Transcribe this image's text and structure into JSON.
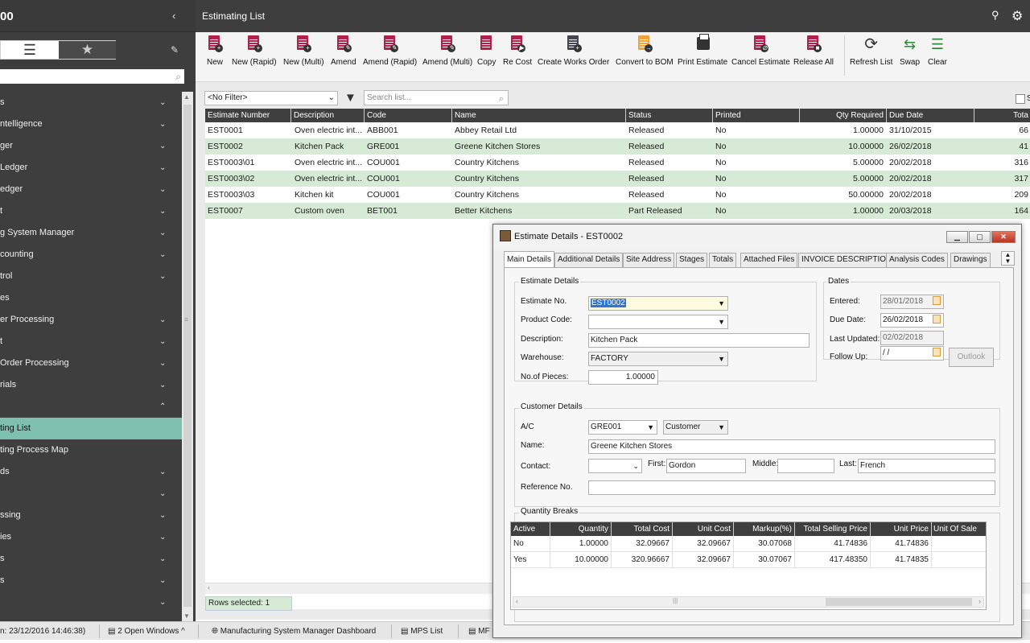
{
  "app": {
    "title": "00",
    "collapse_icon": "‹"
  },
  "sidebar": {
    "pencil_icon": "✎",
    "items": [
      {
        "label": "s",
        "chev": "⌄"
      },
      {
        "label": "ntelligence",
        "chev": "⌄"
      },
      {
        "label": "ger",
        "chev": "⌄"
      },
      {
        "label": "Ledger",
        "chev": "⌄"
      },
      {
        "label": "edger",
        "chev": "⌄"
      },
      {
        "label": "t",
        "chev": "⌄"
      },
      {
        "label": "g System Manager",
        "chev": "⌄"
      },
      {
        "label": "counting",
        "chev": "⌄"
      },
      {
        "label": "trol",
        "chev": "⌄"
      },
      {
        "label": "es",
        "chev": ""
      },
      {
        "label": "er Processing",
        "chev": "⌄"
      },
      {
        "label": "t",
        "chev": "⌄"
      },
      {
        "label": "Order Processing",
        "chev": "⌄"
      },
      {
        "label": "rials",
        "chev": "⌄"
      },
      {
        "label": "",
        "chev": "⌃"
      },
      {
        "label": "ting List",
        "chev": ""
      },
      {
        "label": "ting Process Map",
        "chev": ""
      },
      {
        "label": "ds",
        "chev": "⌄"
      },
      {
        "label": "",
        "chev": "⌄"
      },
      {
        "label": "ssing",
        "chev": "⌄"
      },
      {
        "label": "ies",
        "chev": "⌄"
      },
      {
        "label": "s",
        "chev": "⌄"
      },
      {
        "label": "s",
        "chev": "⌄"
      },
      {
        "label": "",
        "chev": "⌄"
      }
    ]
  },
  "topbar": {
    "title": "Estimating List"
  },
  "ribbon": {
    "buttons": [
      "New",
      "New (Rapid)",
      "New (Multi)",
      "Amend",
      "Amend (Rapid)",
      "Amend (Multi)",
      "Copy",
      "Re Cost",
      "Create Works Order",
      "Convert to BOM",
      "Print Estimate",
      "Cancel Estimate",
      "Release All",
      "Refresh List",
      "Swap",
      "Clear"
    ]
  },
  "list": {
    "filter": "<No Filter>",
    "search_placeholder": "Search list...",
    "columns": [
      "Estimate Number",
      "Description",
      "Code",
      "Name",
      "Status",
      "Printed",
      "Qty Required",
      "Due Date",
      "Tota"
    ],
    "rows": [
      [
        "EST0001",
        "Oven electric int...",
        "ABB001",
        "Abbey Retail Ltd",
        "Released",
        "No",
        "1.00000",
        "31/10/2015",
        "66"
      ],
      [
        "EST0002",
        "Kitchen Pack",
        "GRE001",
        "Greene Kitchen Stores",
        "Released",
        "No",
        "10.00000",
        "26/02/2018",
        "41"
      ],
      [
        "EST0003\\01",
        "Oven electric int...",
        "COU001",
        "Country Kitchens",
        "Released",
        "No",
        "5.00000",
        "20/02/2018",
        "316"
      ],
      [
        "EST0003\\02",
        "Oven electric int...",
        "COU001",
        "Country Kitchens",
        "Released",
        "No",
        "5.00000",
        "20/02/2018",
        "317"
      ],
      [
        "EST0003\\03",
        "Kitchen kit",
        "COU001",
        "Country Kitchens",
        "Released",
        "No",
        "50.00000",
        "20/02/2018",
        "209"
      ],
      [
        "EST0007",
        "Custom oven",
        "BET001",
        "Better Kitchens",
        "Part Released",
        "No",
        "1.00000",
        "20/03/2018",
        "164"
      ]
    ],
    "rows_selected": "Rows selected: 1",
    "show_checkbox_label": "S"
  },
  "statusbar": {
    "items": [
      "n: 23/12/2016 14:46:38)",
      "2 Open Windows ^",
      "Manufacturing System Manager Dashboard",
      "MPS List",
      "MF"
    ]
  },
  "dialog": {
    "title": "Estimate Details - EST0002",
    "tabs": [
      "Main Details",
      "Additional Details",
      "Site Address",
      "Stages",
      "Totals",
      "Attached Files",
      "INVOICE DESCRIPTION",
      "Analysis Codes",
      "Drawings"
    ],
    "estimate_details": {
      "group": "Estimate Details",
      "estimate_no_label": "Estimate No.",
      "estimate_no": "EST0002",
      "product_code_label": "Product Code:",
      "product_code": "",
      "description_label": "Description:",
      "description": "Kitchen Pack",
      "warehouse_label": "Warehouse:",
      "warehouse": "FACTORY",
      "pieces_label": "No.of Pieces:",
      "pieces": "1.00000"
    },
    "dates": {
      "group": "Dates",
      "entered_label": "Entered:",
      "entered": "28/01/2018",
      "due_label": "Due Date:",
      "due": "26/02/2018",
      "updated_label": "Last Updated:",
      "updated": "02/02/2018",
      "follow_label": "Follow Up:",
      "follow": " / /",
      "outlook": "Outlook"
    },
    "customer": {
      "group": "Customer Details",
      "ac_label": "A/C",
      "ac": "GRE001",
      "ac_type": "Customer",
      "name_label": "Name:",
      "name": "Greene Kitchen Stores",
      "contact_label": "Contact:",
      "first_label": "First:",
      "first": "Gordon",
      "middle_label": "Middle:",
      "middle": "",
      "last_label": "Last:",
      "last": "French",
      "ref_label": "Reference No.",
      "ref": ""
    },
    "qb": {
      "group": "Quantity Breaks",
      "columns": [
        "Active",
        "Quantity",
        "Total Cost",
        "Unit Cost",
        "Markup(%)",
        "Total Selling Price",
        "Unit Price",
        "Unit Of Sale"
      ],
      "rows": [
        [
          "No",
          "1.00000",
          "32.09667",
          "32.09667",
          "30.07068",
          "41.74836",
          "41.74836",
          ""
        ],
        [
          "Yes",
          "10.00000",
          "320.96667",
          "32.09667",
          "30.07067",
          "417.48350",
          "41.74835",
          ""
        ]
      ]
    }
  }
}
